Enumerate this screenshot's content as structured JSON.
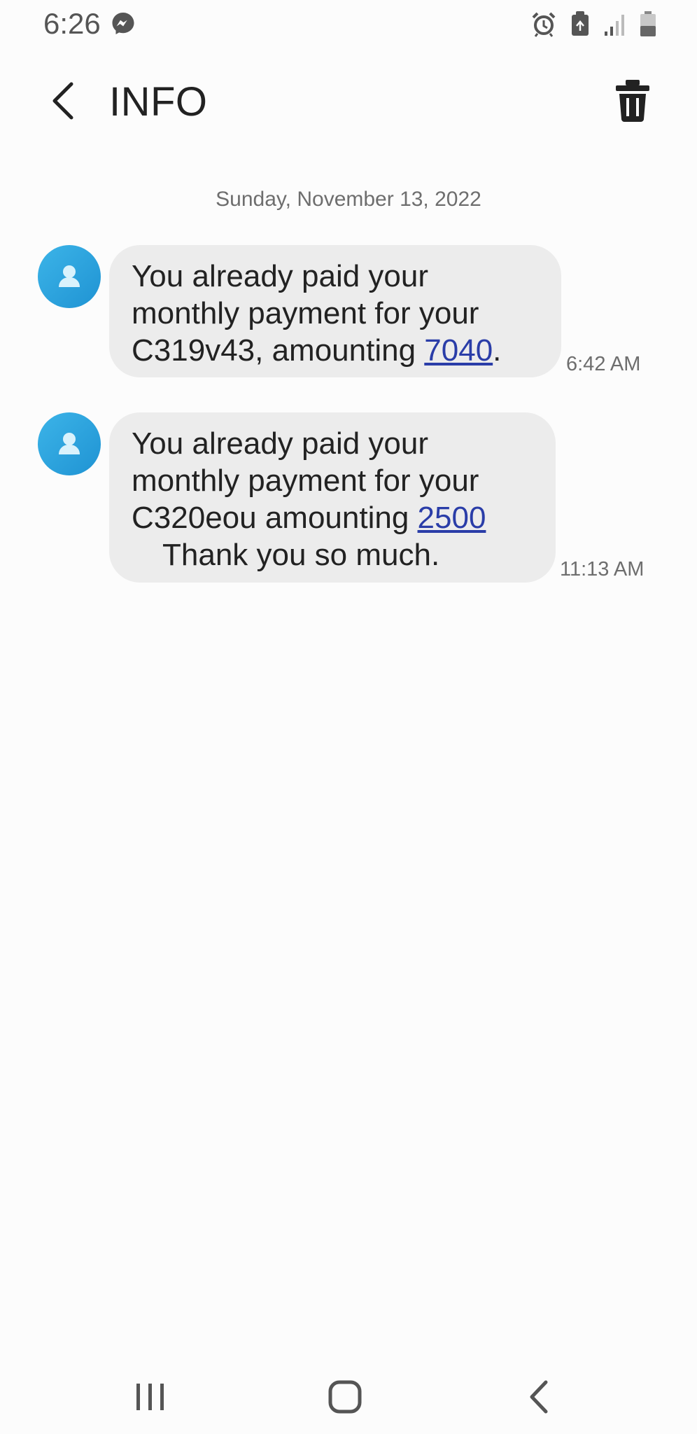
{
  "status_bar": {
    "time": "6:26",
    "left_icons": [
      "messenger-icon"
    ],
    "right_icons": [
      "alarm-icon",
      "storage-icon",
      "signal-icon",
      "battery-icon"
    ]
  },
  "app_bar": {
    "title": "INFO",
    "back_icon": "back-arrow-icon",
    "delete_icon": "trash-icon"
  },
  "conversation": {
    "date": "Sunday, November 13, 2022",
    "messages": [
      {
        "lines": [
          "You already paid your",
          "monthly payment for your"
        ],
        "last_line_before": "C319v43, amounting ",
        "link": "7040",
        "last_line_after": ".",
        "time": "6:42 AM"
      },
      {
        "lines": [
          "You already paid your",
          "monthly payment for your"
        ],
        "last_line_before": "C320eou amounting ",
        "link": "2500",
        "extra_line": "Thank you so much.",
        "time": "11:13 AM"
      }
    ]
  },
  "nav_bar": {
    "buttons": [
      "recents-icon",
      "home-icon",
      "back-icon"
    ]
  },
  "colors": {
    "background": "#fcfcfc",
    "bubble": "#ececec",
    "link": "#2a3da8",
    "avatar": "#1f93d3"
  }
}
